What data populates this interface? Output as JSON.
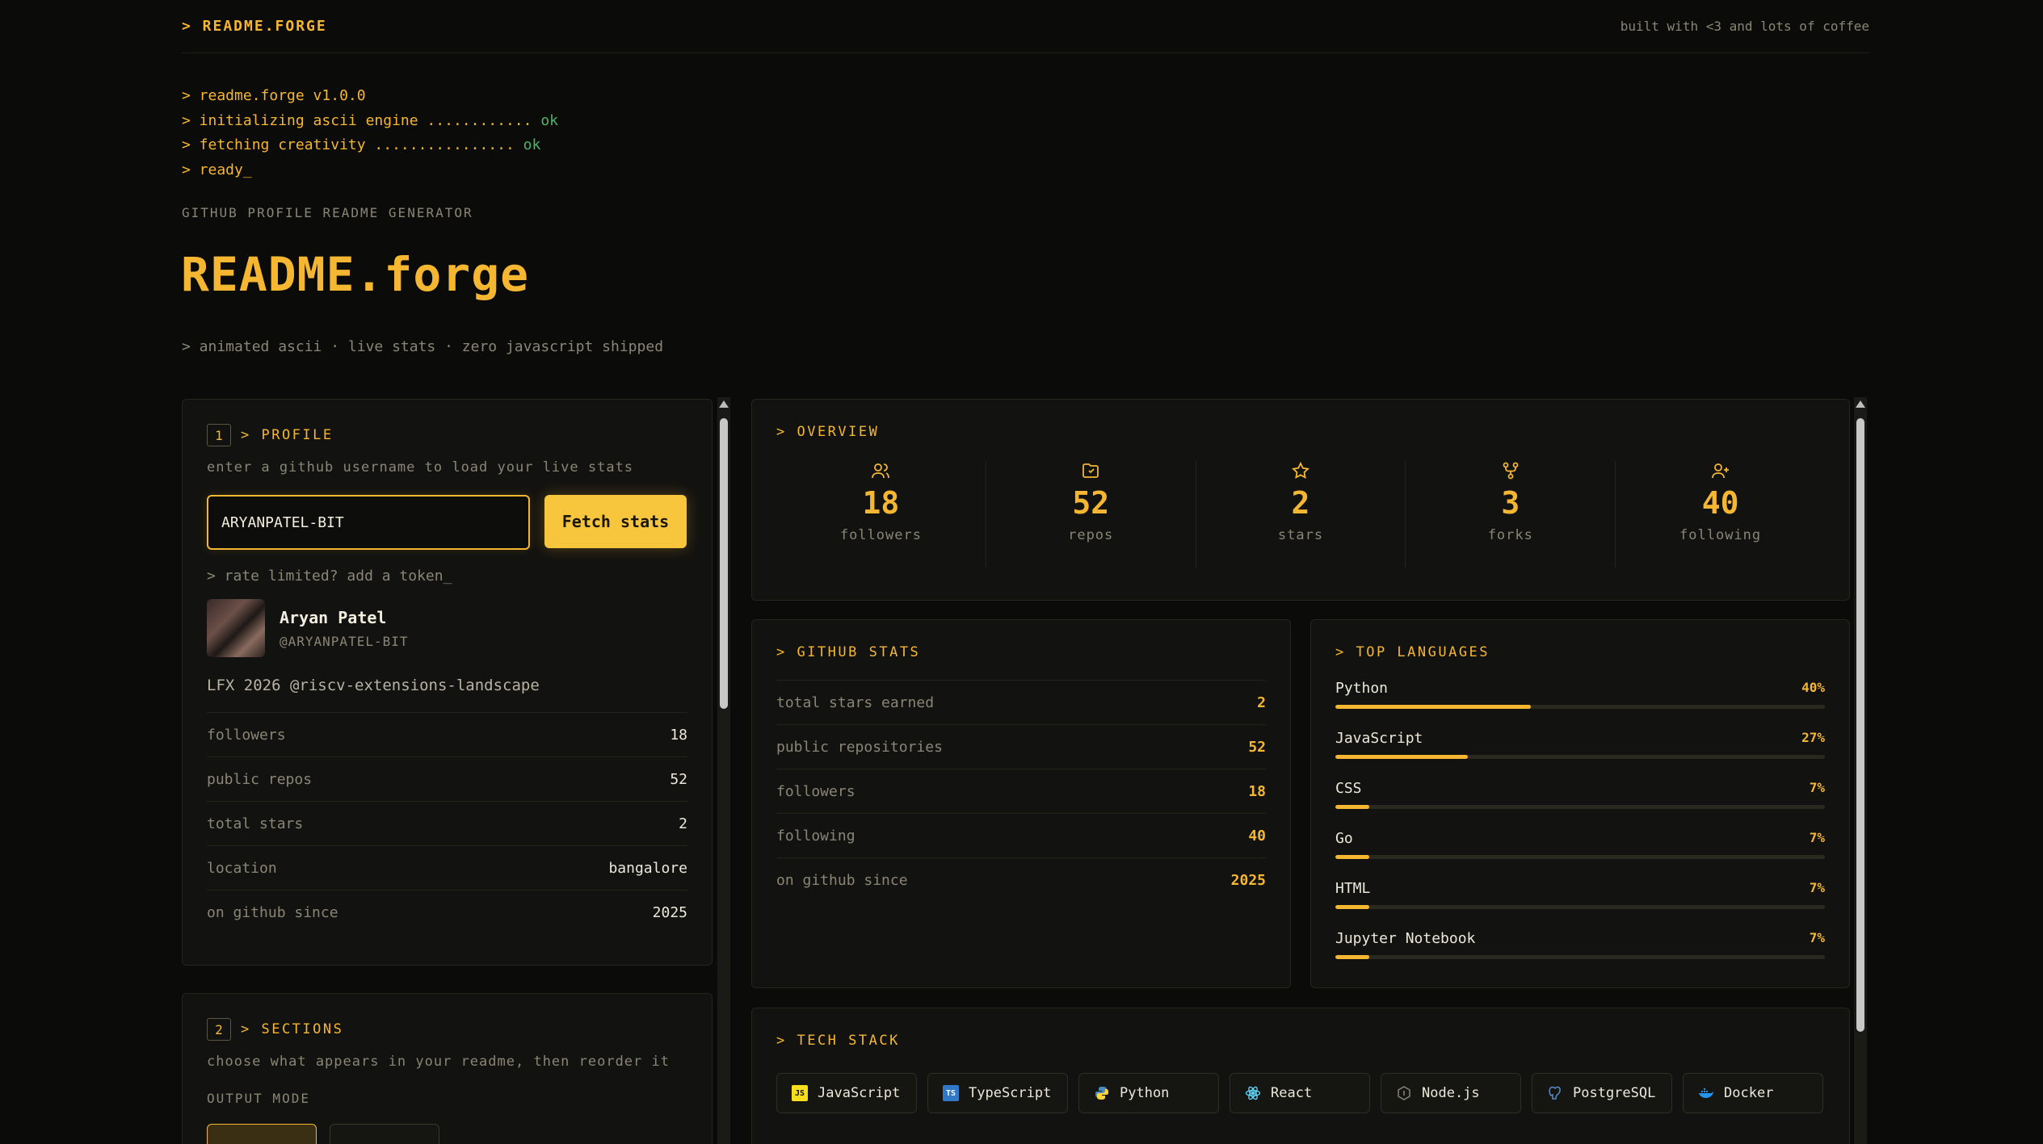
{
  "header": {
    "brand": "> README.FORGE",
    "tagline": "built with <3 and lots of coffee"
  },
  "boot_log": [
    {
      "text": "> readme.forge v1.0.0",
      "status": ""
    },
    {
      "text": "> initializing ascii engine ............ ",
      "status": "ok"
    },
    {
      "text": "> fetching creativity ................ ",
      "status": "ok"
    },
    {
      "text": "> ready_",
      "status": ""
    }
  ],
  "hero": {
    "kicker": "GITHUB PROFILE README GENERATOR",
    "title": "README.forge",
    "subline": "> animated ascii · live stats · zero javascript shipped"
  },
  "profile_panel": {
    "step": "1",
    "title": "> PROFILE",
    "hint": "enter a github username to load your live stats",
    "username_value": "ARYANPATEL-BIT",
    "fetch_label": "Fetch stats",
    "token_link": "> rate limited? add a token_",
    "user": {
      "name": "Aryan Patel",
      "handle": "@ARYANPATEL-BIT",
      "bio": "LFX 2026 @riscv-extensions-landscape"
    },
    "rows": [
      {
        "k": "followers",
        "v": "18"
      },
      {
        "k": "public repos",
        "v": "52"
      },
      {
        "k": "total stars",
        "v": "2"
      },
      {
        "k": "location",
        "v": "bangalore"
      },
      {
        "k": "on github since",
        "v": "2025"
      }
    ]
  },
  "sections_panel": {
    "step": "2",
    "title": "> SECTIONS",
    "hint": "choose what appears in your readme, then reorder it",
    "output_mode": "OUTPUT MODE"
  },
  "overview": {
    "title": "> OVERVIEW",
    "stats": [
      {
        "icon": "followers-icon",
        "value": "18",
        "label": "followers"
      },
      {
        "icon": "repos-icon",
        "value": "52",
        "label": "repos"
      },
      {
        "icon": "star-icon",
        "value": "2",
        "label": "stars"
      },
      {
        "icon": "fork-icon",
        "value": "3",
        "label": "forks"
      },
      {
        "icon": "following-icon",
        "value": "40",
        "label": "following"
      }
    ]
  },
  "github_stats": {
    "title": "> GITHUB STATS",
    "rows": [
      {
        "k": "total stars earned",
        "v": "2"
      },
      {
        "k": "public repositories",
        "v": "52"
      },
      {
        "k": "followers",
        "v": "18"
      },
      {
        "k": "following",
        "v": "40"
      },
      {
        "k": "on github since",
        "v": "2025"
      }
    ]
  },
  "top_languages": {
    "title": "> TOP LANGUAGES",
    "items": [
      {
        "name": "Python",
        "pct_label": "40%",
        "pct": 40
      },
      {
        "name": "JavaScript",
        "pct_label": "27%",
        "pct": 27
      },
      {
        "name": "CSS",
        "pct_label": "7%",
        "pct": 7
      },
      {
        "name": "Go",
        "pct_label": "7%",
        "pct": 7
      },
      {
        "name": "HTML",
        "pct_label": "7%",
        "pct": 7
      },
      {
        "name": "Jupyter Notebook",
        "pct_label": "7%",
        "pct": 7
      }
    ]
  },
  "tech_stack": {
    "title": "> TECH STACK",
    "chips": [
      {
        "label": "JavaScript",
        "icon": "javascript-icon",
        "color": "#f7df1e"
      },
      {
        "label": "TypeScript",
        "icon": "typescript-icon",
        "color": "#3178c6"
      },
      {
        "label": "Python",
        "icon": "python-icon",
        "color": "#4b8bbe"
      },
      {
        "label": "React",
        "icon": "react-icon",
        "color": "#61dafb"
      },
      {
        "label": "Node.js",
        "icon": "nodejs-icon",
        "color": "#8a8675"
      },
      {
        "label": "PostgreSQL",
        "icon": "postgresql-icon",
        "color": "#336791"
      },
      {
        "label": "Docker",
        "icon": "docker-icon",
        "color": "#2496ed"
      }
    ]
  },
  "colors": {
    "accent": "#f5b731",
    "ok": "#4fb36a",
    "background": "#0b0b09",
    "panel": "#121210"
  }
}
